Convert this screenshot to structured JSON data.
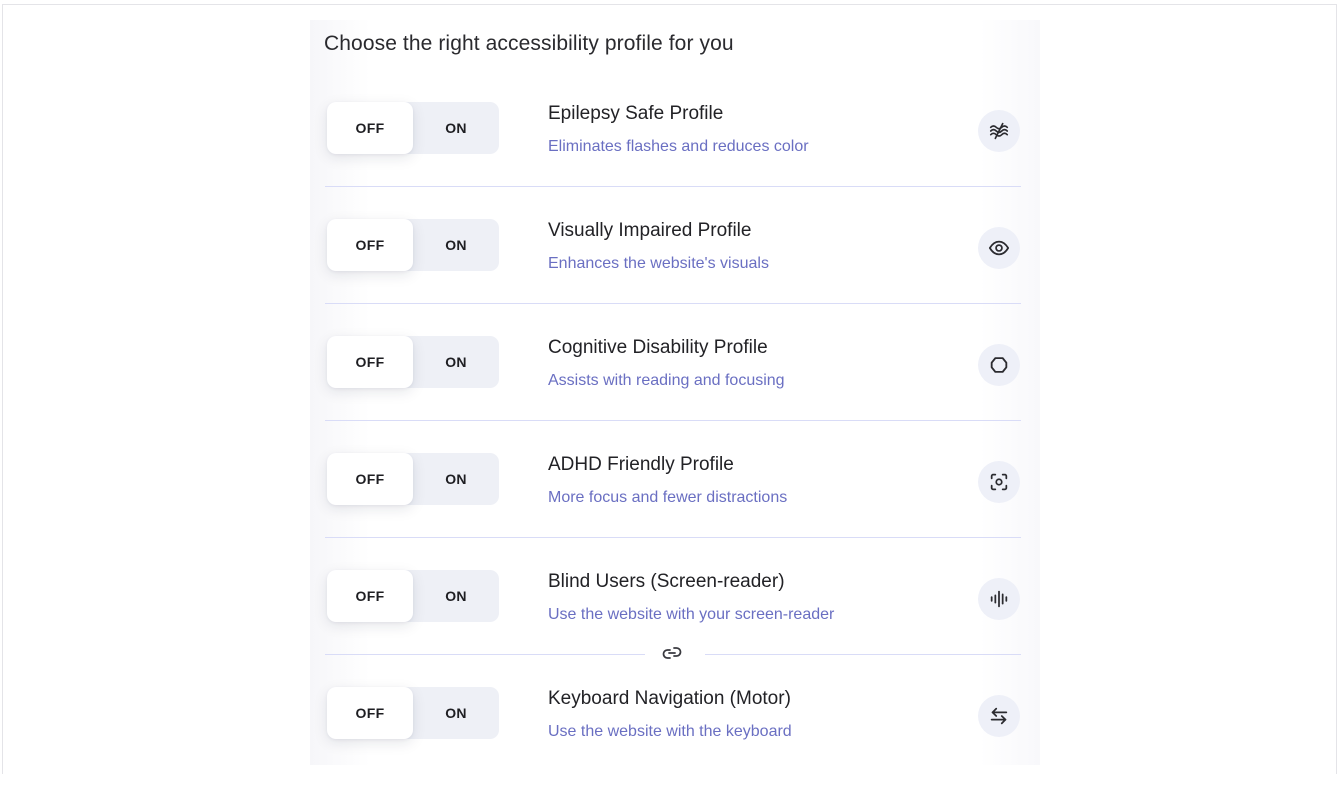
{
  "heading": "Choose the right accessibility profile for you",
  "toggle": {
    "off_label": "OFF",
    "on_label": "ON"
  },
  "profiles": [
    {
      "title": "Epilepsy Safe Profile",
      "description": "Eliminates flashes and reduces color",
      "icon": "waves-slash-icon",
      "state": "OFF"
    },
    {
      "title": "Visually Impaired Profile",
      "description": "Enhances the website's visuals",
      "icon": "eye-icon",
      "state": "OFF"
    },
    {
      "title": "Cognitive Disability Profile",
      "description": "Assists with reading and focusing",
      "icon": "brain-outline-icon",
      "state": "OFF"
    },
    {
      "title": "ADHD Friendly Profile",
      "description": "More focus and fewer distractions",
      "icon": "focus-target-icon",
      "state": "OFF"
    },
    {
      "title": "Blind Users (Screen-reader)",
      "description": "Use the website with your screen-reader",
      "icon": "audio-waveform-icon",
      "state": "OFF"
    },
    {
      "title": "Keyboard Navigation (Motor)",
      "description": "Use the website with the keyboard",
      "icon": "arrows-left-right-icon",
      "state": "OFF"
    }
  ],
  "colors": {
    "title_text": "#222226",
    "description_text": "#6a6fc2",
    "divider": "#d9dcf7",
    "toggle_track": "#eef0f6",
    "icon_badge": "#eef0f8"
  }
}
